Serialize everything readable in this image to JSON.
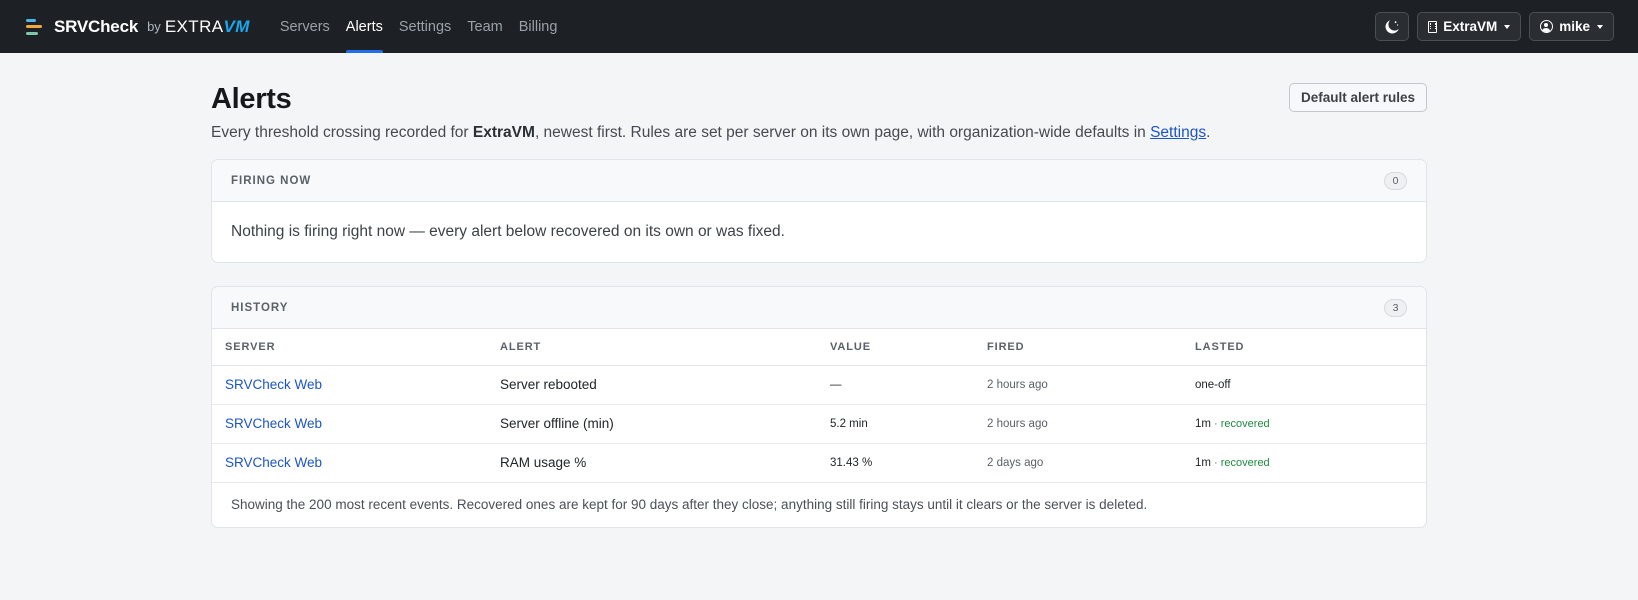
{
  "brand": {
    "name": "SRVCheck",
    "by": "by",
    "partner_prefix": "EXTRA",
    "partner_suffix": "VM"
  },
  "nav": {
    "links": [
      {
        "label": "Servers",
        "active": false
      },
      {
        "label": "Alerts",
        "active": true
      },
      {
        "label": "Settings",
        "active": false
      },
      {
        "label": "Team",
        "active": false
      },
      {
        "label": "Billing",
        "active": false
      }
    ],
    "org_label": "ExtraVM",
    "user_label": "mike"
  },
  "page": {
    "title": "Alerts",
    "default_rules_button": "Default alert rules",
    "lead_before": "Every threshold crossing recorded for ",
    "lead_org": "ExtraVM",
    "lead_middle": ", newest first. Rules are set per server on its own page, with organization-wide defaults in ",
    "lead_link": "Settings",
    "lead_after": "."
  },
  "firing": {
    "title": "FIRING NOW",
    "count": "0",
    "empty_message": "Nothing is firing right now — every alert below recovered on its own or was fixed."
  },
  "history": {
    "title": "HISTORY",
    "count": "3",
    "columns": [
      "SERVER",
      "ALERT",
      "VALUE",
      "FIRED",
      "LASTED"
    ],
    "rows": [
      {
        "server": "SRVCheck Web",
        "alert": "Server rebooted",
        "value": "—",
        "fired": "2 hours ago",
        "lasted": "one-off",
        "status": ""
      },
      {
        "server": "SRVCheck Web",
        "alert": "Server offline (min)",
        "value": "5.2 min",
        "fired": "2 hours ago",
        "lasted": "1m",
        "status": " · recovered"
      },
      {
        "server": "SRVCheck Web",
        "alert": "RAM usage %",
        "value": "31.43 %",
        "fired": "2 days ago",
        "lasted": "1m",
        "status": " · recovered"
      }
    ],
    "footer_note": "Showing the 200 most recent events. Recovered ones are kept for 90 days after they close; anything still firing stays until it clears or the server is deleted."
  },
  "colors": {
    "navbar_bg": "#1d2024",
    "accent_link": "#1c55c4",
    "active_tab_underline": "#1f6feb",
    "recovered_green": "#1f8a3f",
    "partner_blue": "#1aa7ec"
  }
}
